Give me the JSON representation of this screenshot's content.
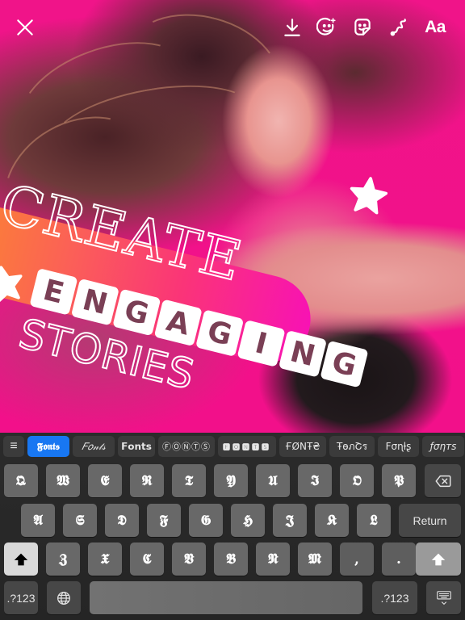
{
  "topbar": {
    "close_icon": "close-icon",
    "tools": [
      {
        "name": "download",
        "icon": "download-icon"
      },
      {
        "name": "face-effects",
        "icon": "face-sparkle-icon"
      },
      {
        "name": "sticker",
        "icon": "sticker-icon"
      },
      {
        "name": "draw",
        "icon": "squiggle-draw-icon"
      },
      {
        "name": "text",
        "label": "Aa"
      }
    ]
  },
  "story": {
    "headline_line1": "CREATE",
    "headline_line2_letters": [
      "E",
      "N",
      "G",
      "A",
      "G",
      "I",
      "N",
      "G"
    ],
    "headline_line3": "STORIES",
    "colors": {
      "background": "#f0128a",
      "bubble_start": "#fb8a2c",
      "bubble_end": "#f812b4",
      "text": "#ffffff"
    }
  },
  "font_bar": {
    "menu_icon": "≡",
    "active_index": 0,
    "active_color": "#1877f2",
    "fonts": [
      "𝕱𝖔𝖓𝖙𝖘",
      "𝐹𝑜𝓃𝓉𝓈",
      "𝗙𝗼𝗻𝘁𝘀",
      "ⒻⓄⓃⓉⓈ",
      "🅵🅾🅽🆃🆂",
      "ҒØNŦ₴",
      "ŦѳภՇร",
      "Fσɳƚʂ",
      "ƒσηтѕ"
    ]
  },
  "keyboard": {
    "row1": [
      "𝕼",
      "𝖂",
      "𝕰",
      "𝕽",
      "𝕿",
      "𝖄",
      "𝖀",
      "𝕴",
      "𝕺",
      "𝕻"
    ],
    "row2": [
      "𝕬",
      "𝕾",
      "𝕯",
      "𝕱",
      "𝕲",
      "𝕳",
      "𝕵",
      "𝕶",
      "𝕷"
    ],
    "row3": [
      "𝖅",
      "𝖃",
      "𝕮",
      "𝖁",
      "𝕭",
      "𝕹",
      "𝕸",
      ",",
      "."
    ],
    "return_label": "Return",
    "numbers_label": ".?123",
    "backspace_icon": "backspace-icon",
    "shift_icon": "shift-arrow-icon",
    "globe_icon": "globe-icon",
    "dismiss_icon": "keyboard-dismiss-icon"
  }
}
